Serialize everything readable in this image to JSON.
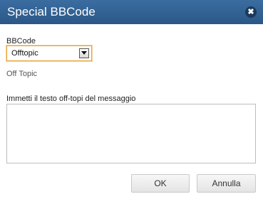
{
  "dialog": {
    "title": "Special BBCode",
    "close_icon": "close-icon"
  },
  "form": {
    "bbcode_label": "BBCode",
    "bbcode_selected": "Offtopic",
    "preview_text": "Off Topic",
    "message_label": "Immetti il testo off-topi del messaggio",
    "message_value": ""
  },
  "buttons": {
    "ok_label": "OK",
    "cancel_label": "Annulla"
  },
  "colors": {
    "titlebar": "#2f6395",
    "select_focus_border": "#e8a13a"
  }
}
